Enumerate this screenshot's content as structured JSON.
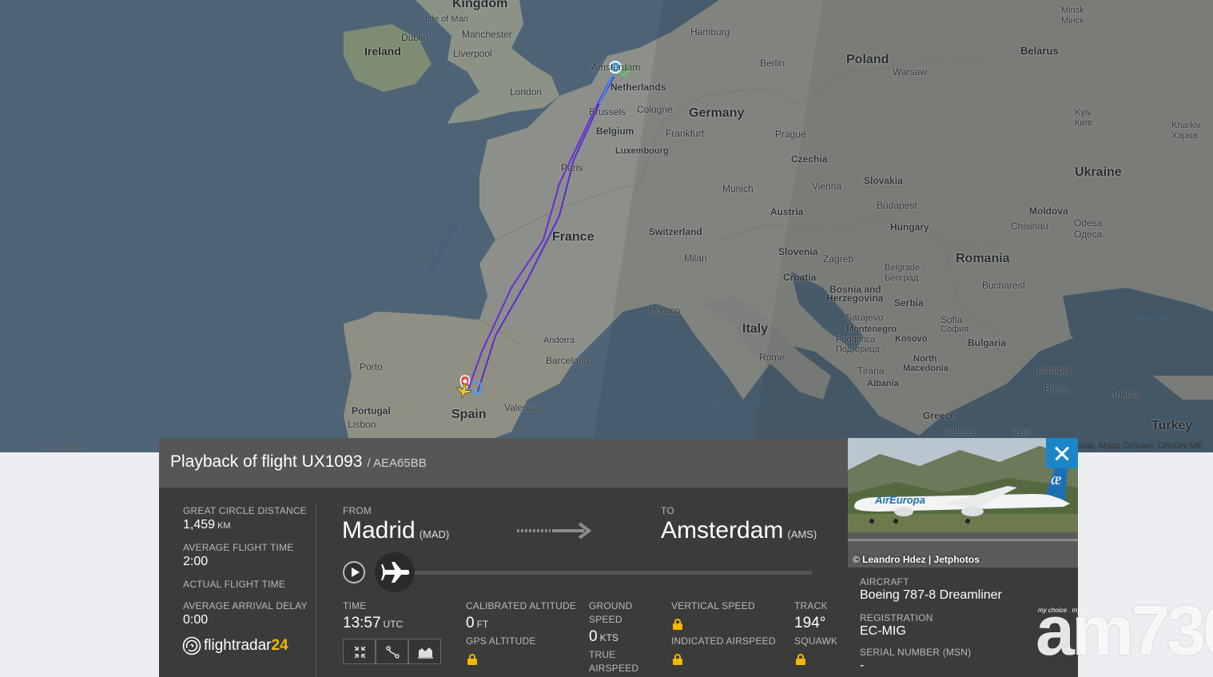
{
  "map": {
    "attribution": "onal, Mapa GISrael, ORION-ME",
    "corner_label": "Ponta Delgada",
    "countries": [
      {
        "name": "Kingdom"
      },
      {
        "name": "Ireland"
      },
      {
        "name": "Poland"
      },
      {
        "name": "Belarus"
      },
      {
        "name": "Germany"
      },
      {
        "name": "Ukraine"
      },
      {
        "name": "France"
      },
      {
        "name": "Romania"
      },
      {
        "name": "Italy"
      },
      {
        "name": "Spain"
      },
      {
        "name": "Turkey"
      }
    ],
    "cities": [
      "Isle of Man",
      "Dublin",
      "Manchester",
      "Liverpool",
      "London",
      "Hamburg",
      "Berlin",
      "Warsaw",
      "Minsk",
      "Мінск",
      "Amsterdam",
      "Netherlands",
      "Brussels",
      "Cologne",
      "Belgium",
      "Frankfurt",
      "Luxembourg",
      "Prague",
      "Czechia",
      "Kyiv",
      "Київ",
      "Kharkiv",
      "Харків",
      "Paris",
      "Munich",
      "Vienna",
      "Slovakia",
      "Austria",
      "Budapest",
      "Hungary",
      "Moldova",
      "Chisinau",
      "Odesa",
      "Одеса",
      "Switzerland",
      "Milan",
      "Slovenia",
      "Zagreb",
      "Croatia",
      "Bosnia and",
      "Herzegovina",
      "Belgrade",
      "Београд",
      "Serbia",
      "Bucharest",
      "Monaco",
      "Sarajevo",
      "Montenegro",
      "Podgorica",
      "Подгорица",
      "Kosovo",
      "Sofia",
      "София",
      "Bulgaria",
      "Andorra",
      "Rome",
      "North",
      "Macedonia",
      "Tirana",
      "Albania",
      "Istanbul",
      "Porto",
      "Barcelona",
      "Bursa",
      "Ankara",
      "Portugal",
      "Lisbon",
      "Valencia",
      "Greece",
      "Athens",
      "İzmir"
    ],
    "seas": [
      "Bay of Biscay",
      "Tyrrhenian Sea",
      "Black Sea"
    ]
  },
  "flight": {
    "title": "Playback of flight UX1093",
    "subtitle": "/ AEA65BB",
    "stats": {
      "great_circle_label": "GREAT CIRCLE DISTANCE",
      "great_circle_value": "1,459",
      "great_circle_unit": "KM",
      "avg_flight_time_label": "AVERAGE FLIGHT TIME",
      "avg_flight_time_value": "2:00",
      "actual_flight_time_label": "ACTUAL FLIGHT TIME",
      "avg_arrival_delay_label": "AVERAGE ARRIVAL DELAY",
      "avg_arrival_delay_value": "0:00"
    },
    "logo_text": "flightradar",
    "logo_num": "24",
    "from_label": "FROM",
    "from_city": "Madrid",
    "from_code": "(MAD)",
    "to_label": "TO",
    "to_city": "Amsterdam",
    "to_code": "(AMS)",
    "time_label": "TIME",
    "time_value": "13:57",
    "time_unit": "UTC",
    "cal_alt_label": "CALIBRATED ALTITUDE",
    "cal_alt_value": "0",
    "cal_alt_unit": "FT",
    "gps_alt_label": "GPS ALTITUDE",
    "ground_speed_label_1": "GROUND",
    "ground_speed_label_2": "SPEED",
    "ground_speed_value": "0",
    "ground_speed_unit": "KTS",
    "true_airspeed_label_1": "TRUE",
    "true_airspeed_label_2": "AIRSPEED",
    "vertical_speed_label": "VERTICAL SPEED",
    "indicated_airspeed_label": "INDICATED AIRSPEED",
    "track_label": "TRACK",
    "track_value": "194°",
    "squawk_label": "SQUAWK"
  },
  "aircraft": {
    "photo_credit": "© Leandro Hdez | Jetphotos",
    "aircraft_label": "AIRCRAFT",
    "aircraft_value": "Boeing 787-8 Dreamliner",
    "registration_label": "REGISTRATION",
    "registration_value": "EC-MIG",
    "serial_label": "SERIAL NUMBER (MSN)",
    "serial_value": "-",
    "livery_text": "AirEuropa"
  },
  "watermark": {
    "small": "my choice . my ...",
    "big": "am730"
  },
  "colors": {
    "panel_bg": "#3b3b3b",
    "panel_head": "#565656",
    "accent_blue": "#1a86c7",
    "lock_yellow": "#f2b705",
    "route_purple": "#6a2cd8"
  }
}
